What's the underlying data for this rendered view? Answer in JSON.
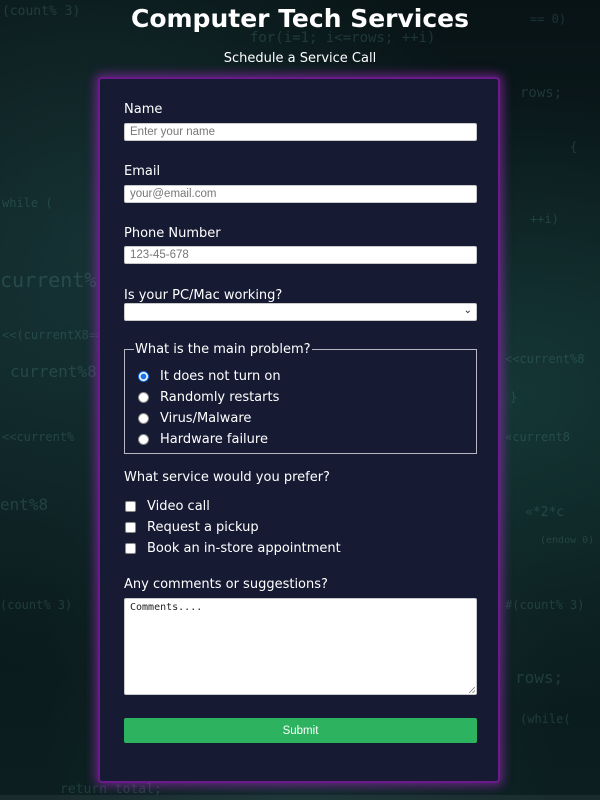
{
  "header": {
    "title": "Computer Tech Services",
    "subtitle": "Schedule a Service Call"
  },
  "background": {
    "code_lines": [
      "(count% 3)",
      "for(i=1; i<=rows; ++i)",
      "rows;",
      "current%",
      "current%8",
      "while (",
      "++i)",
      "<<current%",
      "«current8",
      "ent%8",
      "(count% 3)",
      "rows;",
      "(while(",
      "return total;",
      "== 0)",
      "<<current%8",
      "<<(currentX8==",
      "#(count% 3)",
      "{",
      "}",
      "«*2*c",
      "(endow 0)"
    ]
  },
  "form": {
    "name": {
      "label": "Name",
      "placeholder": "Enter your name"
    },
    "email": {
      "label": "Email",
      "placeholder": "your@email.com"
    },
    "phone": {
      "label": "Phone Number",
      "placeholder": "123-45-678"
    },
    "working": {
      "label": "Is your PC/Mac working?",
      "value": ""
    },
    "problem": {
      "legend": "What is the main problem?",
      "options": [
        {
          "label": "It does not turn on",
          "checked": true
        },
        {
          "label": "Randomly restarts",
          "checked": false
        },
        {
          "label": "Virus/Malware",
          "checked": false
        },
        {
          "label": "Hardware failure",
          "checked": false
        }
      ]
    },
    "service": {
      "label": "What service would you prefer?",
      "options": [
        {
          "label": "Video call",
          "checked": false
        },
        {
          "label": "Request a pickup",
          "checked": false
        },
        {
          "label": "Book an in-store appointment",
          "checked": false
        }
      ]
    },
    "comments": {
      "label": "Any comments or suggestions?",
      "placeholder": "Comments...."
    },
    "submit_label": "Submit"
  },
  "colors": {
    "card_bg": "#161a33",
    "card_border": "#6a1a8a",
    "submit_bg": "#2db25f",
    "radio_accent": "#1a73e8"
  }
}
